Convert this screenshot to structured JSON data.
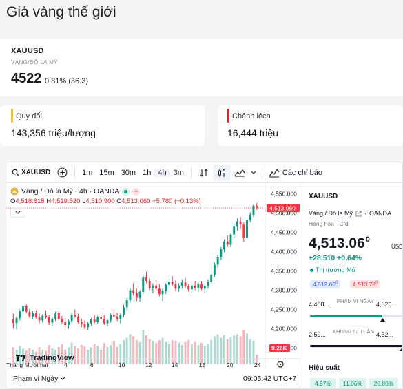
{
  "page": {
    "title": "Giá vàng thế giới"
  },
  "quote": {
    "symbol": "XAUUSD",
    "subtitle": "VÀNG/ĐÔ LA MỸ",
    "price": "4522",
    "change": "0.81% (36.3)"
  },
  "conversion": {
    "label": "Quy đổi",
    "value": "143,356 triệu/lượng"
  },
  "difference": {
    "label": "Chênh lệch",
    "value": "16,444 triệu"
  },
  "toolbar": {
    "symbol": "XAUUSD",
    "intervals": [
      "1m",
      "15m",
      "30m",
      "1h",
      "4h",
      "3m"
    ],
    "active_interval": "4h",
    "indicators_label": "Các chỉ báo"
  },
  "legend": {
    "title": "Vàng / Đô la Mỹ · 4h · OANDA",
    "o_label": "O",
    "o": "4,518.815",
    "h_label": "H",
    "h": "4,519.520",
    "l_label": "L",
    "l": "4,510.900",
    "c_label": "C",
    "c": "4,513.060",
    "chg": "−5.780 (−0.13%)"
  },
  "branding": {
    "logo_text": "TradingView"
  },
  "bottom": {
    "range_label": "Phạm vi Ngày",
    "time": "09:05:42 UTC+7"
  },
  "side": {
    "symbol": "XAUUSD",
    "name": "Vàng / Đô la Mỹ",
    "exchange": "OANDA",
    "category": "Hàng hóa · Cfd",
    "price_main": "4,513.06",
    "price_sup": "0",
    "currency": "USD",
    "change": "+28.510  +0.64%",
    "status": "Thị trường Mở",
    "bid": "4,512.68",
    "bid_sup": "0",
    "ask": "4,513.78",
    "ask_sup": "0",
    "day_low": "4,488...",
    "day_high": "4,526...",
    "day_label": "PHẠM VI NGÀY",
    "day_position": 0.78,
    "w52_low": "2,59...",
    "w52_high": "4,52...",
    "w52_label": "KHUNG 52 TUẦN",
    "w52_position": 0.99,
    "perf_title": "Hiệu suất",
    "perf": [
      "4.97%",
      "11.06%",
      "20.80%"
    ]
  },
  "chart_data": {
    "type": "candlestick",
    "interval": "4h",
    "x_tick_labels": [
      "Tháng Mười hai",
      "4",
      "6",
      "10",
      "12",
      "14",
      "18",
      "20",
      "24"
    ],
    "y_tick_labels": [
      "4,550.000",
      "4,500.000",
      "4,450.000",
      "4,400.000",
      "4,350.000",
      "4,300.000",
      "4,250.000",
      "4,200.000",
      "4,150.000"
    ],
    "ylim": [
      4135,
      4565
    ],
    "last_price_label": "4,513.060",
    "volume_label": "9.26K",
    "up_color": "#089981",
    "down_color": "#f23645",
    "candles": [
      [
        4224,
        4240,
        4200,
        4215
      ],
      [
        4215,
        4232,
        4198,
        4228
      ],
      [
        4228,
        4250,
        4222,
        4245
      ],
      [
        4245,
        4262,
        4238,
        4258
      ],
      [
        4258,
        4264,
        4240,
        4244
      ],
      [
        4244,
        4252,
        4228,
        4232
      ],
      [
        4232,
        4246,
        4224,
        4240
      ],
      [
        4240,
        4248,
        4226,
        4230
      ],
      [
        4230,
        4240,
        4214,
        4222
      ],
      [
        4222,
        4238,
        4216,
        4234
      ],
      [
        4234,
        4248,
        4226,
        4230
      ],
      [
        4230,
        4236,
        4210,
        4216
      ],
      [
        4216,
        4230,
        4208,
        4226
      ],
      [
        4226,
        4244,
        4220,
        4240
      ],
      [
        4240,
        4246,
        4222,
        4226
      ],
      [
        4226,
        4234,
        4212,
        4218
      ],
      [
        4218,
        4228,
        4204,
        4210
      ],
      [
        4210,
        4224,
        4200,
        4220
      ],
      [
        4220,
        4242,
        4214,
        4236
      ],
      [
        4236,
        4250,
        4228,
        4232
      ],
      [
        4232,
        4240,
        4214,
        4218
      ],
      [
        4218,
        4226,
        4204,
        4212
      ],
      [
        4212,
        4222,
        4198,
        4204
      ],
      [
        4204,
        4218,
        4196,
        4214
      ],
      [
        4214,
        4228,
        4208,
        4224
      ],
      [
        4224,
        4236,
        4214,
        4218
      ],
      [
        4218,
        4234,
        4212,
        4230
      ],
      [
        4230,
        4242,
        4222,
        4226
      ],
      [
        4226,
        4236,
        4210,
        4214
      ],
      [
        4214,
        4226,
        4206,
        4222
      ],
      [
        4222,
        4240,
        4216,
        4236
      ],
      [
        4236,
        4250,
        4228,
        4232
      ],
      [
        4232,
        4242,
        4220,
        4226
      ],
      [
        4226,
        4240,
        4214,
        4236
      ],
      [
        4236,
        4262,
        4230,
        4256
      ],
      [
        4256,
        4280,
        4248,
        4274
      ],
      [
        4274,
        4306,
        4268,
        4300
      ],
      [
        4300,
        4318,
        4286,
        4292
      ],
      [
        4292,
        4304,
        4272,
        4280
      ],
      [
        4280,
        4300,
        4270,
        4296
      ],
      [
        4296,
        4340,
        4290,
        4334
      ],
      [
        4334,
        4348,
        4318,
        4324
      ],
      [
        4324,
        4330,
        4300,
        4306
      ],
      [
        4306,
        4318,
        4292,
        4312
      ],
      [
        4312,
        4326,
        4298,
        4304
      ],
      [
        4304,
        4316,
        4284,
        4290
      ],
      [
        4290,
        4304,
        4272,
        4298
      ],
      [
        4298,
        4318,
        4290,
        4314
      ],
      [
        4314,
        4330,
        4304,
        4322
      ],
      [
        4322,
        4336,
        4310,
        4316
      ],
      [
        4316,
        4326,
        4298,
        4304
      ],
      [
        4304,
        4318,
        4296,
        4312
      ],
      [
        4312,
        4328,
        4304,
        4320
      ],
      [
        4320,
        4332,
        4306,
        4310
      ],
      [
        4310,
        4316,
        4296,
        4302
      ],
      [
        4302,
        4316,
        4292,
        4312
      ],
      [
        4312,
        4324,
        4300,
        4306
      ],
      [
        4306,
        4320,
        4296,
        4316
      ],
      [
        4316,
        4324,
        4300,
        4304
      ],
      [
        4304,
        4314,
        4294,
        4310
      ],
      [
        4310,
        4328,
        4304,
        4322
      ],
      [
        4322,
        4344,
        4316,
        4340
      ],
      [
        4340,
        4372,
        4334,
        4366
      ],
      [
        4366,
        4392,
        4358,
        4386
      ],
      [
        4386,
        4412,
        4378,
        4406
      ],
      [
        4406,
        4432,
        4398,
        4426
      ],
      [
        4426,
        4442,
        4412,
        4418
      ],
      [
        4418,
        4448,
        4412,
        4444
      ],
      [
        4444,
        4472,
        4436,
        4466
      ],
      [
        4466,
        4486,
        4454,
        4478
      ],
      [
        4478,
        4490,
        4460,
        4470
      ],
      [
        4470,
        4476,
        4424,
        4436
      ],
      [
        4436,
        4488,
        4430,
        4482
      ],
      [
        4482,
        4502,
        4476,
        4496
      ],
      [
        4496,
        4522,
        4490,
        4519
      ],
      [
        4519,
        4526,
        4508,
        4513
      ]
    ],
    "volumes": [
      0.35,
      0.3,
      0.38,
      0.32,
      0.28,
      0.34,
      0.3,
      0.26,
      0.36,
      0.3,
      0.28,
      0.4,
      0.33,
      0.3,
      0.36,
      0.42,
      0.3,
      0.35,
      0.45,
      0.38,
      0.33,
      0.4,
      0.37,
      0.3,
      0.35,
      0.42,
      0.38,
      0.3,
      0.44,
      0.36,
      0.4,
      0.48,
      0.36,
      0.42,
      0.5,
      0.55,
      0.62,
      0.58,
      0.5,
      0.46,
      0.7,
      0.6,
      0.52,
      0.48,
      0.44,
      0.5,
      0.55,
      0.46,
      0.42,
      0.5,
      0.48,
      0.44,
      0.4,
      0.46,
      0.5,
      0.42,
      0.46,
      0.4,
      0.44,
      0.38,
      0.42,
      0.5,
      0.58,
      0.62,
      0.55,
      0.6,
      0.52,
      0.56,
      0.6,
      0.62,
      0.58,
      0.7,
      0.64,
      0.52,
      0.48,
      0.2
    ]
  }
}
